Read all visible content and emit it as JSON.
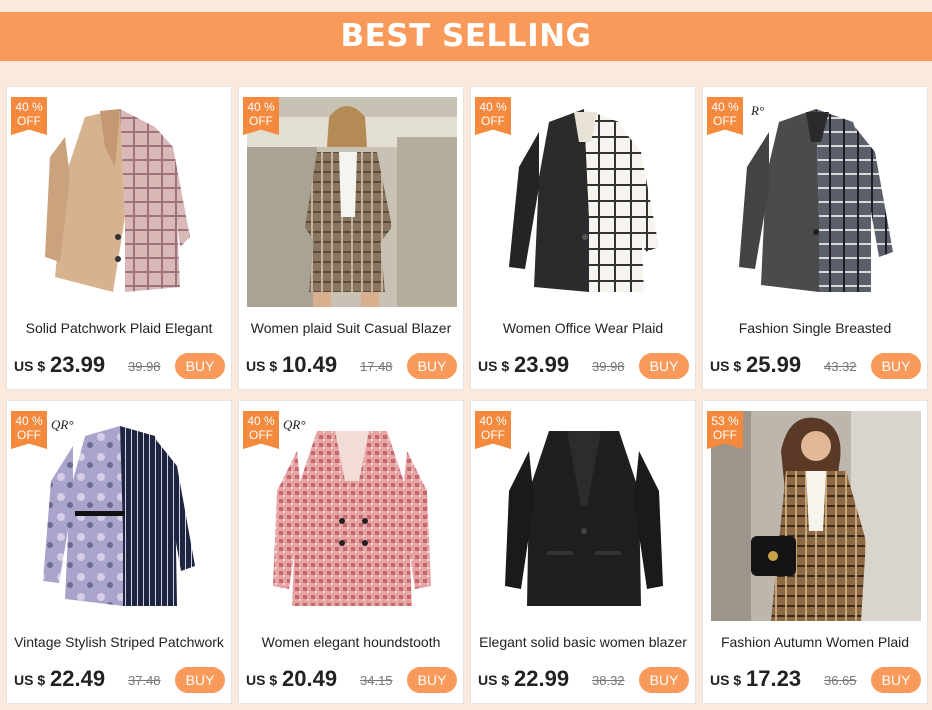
{
  "banner": {
    "title": "BEST SELLING"
  },
  "currency": "US $",
  "products": [
    {
      "title": "Solid Patchwork Plaid Elegant",
      "price": "23.99",
      "old_price": "39.98",
      "badge_pct": "40",
      "badge_pct_sign": "%",
      "badge_off": "OFF",
      "buy": "BUY",
      "image": "camel-plaid-blazer"
    },
    {
      "title": "Women plaid Suit Casual Blazer",
      "price": "10.49",
      "old_price": "17.48",
      "badge_pct": "40",
      "badge_pct_sign": "%",
      "badge_off": "OFF",
      "buy": "BUY",
      "image": "model-plaid-suit"
    },
    {
      "title": "Women Office Wear Plaid",
      "price": "23.99",
      "old_price": "39.98",
      "badge_pct": "40",
      "badge_pct_sign": "%",
      "badge_off": "OFF",
      "buy": "BUY",
      "image": "black-white-plaid-blazer"
    },
    {
      "title": "Fashion Single Breasted",
      "price": "25.99",
      "old_price": "43.32",
      "badge_pct": "40",
      "badge_pct_sign": "%",
      "badge_off": "OFF",
      "buy": "BUY",
      "image": "grey-plaid-blazer"
    },
    {
      "title": "Vintage Stylish Striped Patchwork",
      "price": "22.49",
      "old_price": "37.48",
      "badge_pct": "40",
      "badge_pct_sign": "%",
      "badge_off": "OFF",
      "buy": "BUY",
      "image": "floral-striped-blazer"
    },
    {
      "title": "Women elegant houndstooth",
      "price": "20.49",
      "old_price": "34.15",
      "badge_pct": "40",
      "badge_pct_sign": "%",
      "badge_off": "OFF",
      "buy": "BUY",
      "image": "red-houndstooth-blazer"
    },
    {
      "title": "Elegant solid basic women blazer",
      "price": "22.99",
      "old_price": "38.32",
      "badge_pct": "40",
      "badge_pct_sign": "%",
      "badge_off": "OFF",
      "buy": "BUY",
      "image": "black-blazer"
    },
    {
      "title": "Fashion Autumn Women Plaid",
      "price": "17.23",
      "old_price": "36.65",
      "badge_pct": "53",
      "badge_pct_sign": "%",
      "badge_off": "OFF",
      "buy": "BUY",
      "image": "model-brown-plaid-blazer"
    }
  ],
  "colors": {
    "banner": "#f99a5a",
    "badge": "#f5893e",
    "button": "#f99a5a",
    "page_bg": "#fbe9dc"
  }
}
